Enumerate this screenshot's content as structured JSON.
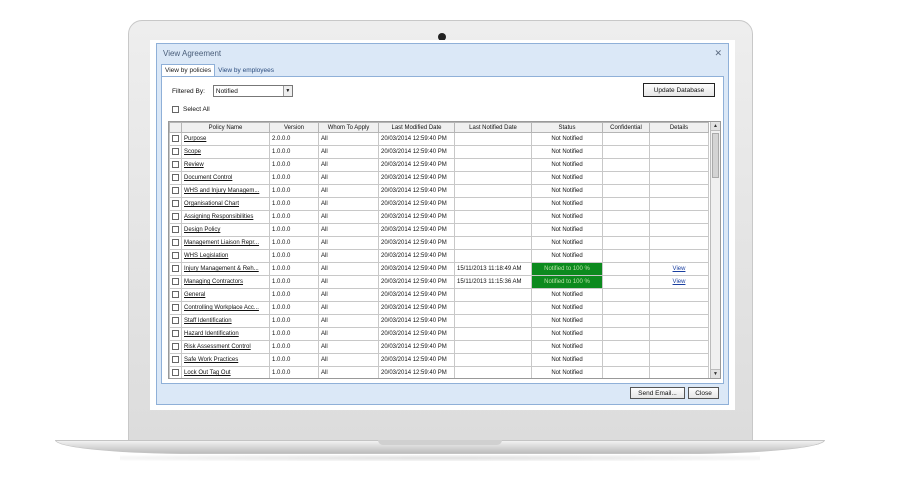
{
  "window": {
    "title": "View Agreement",
    "close_icon": "close-icon"
  },
  "tabs": [
    {
      "label": "View by policies",
      "active": true
    },
    {
      "label": "View by employees",
      "active": false
    }
  ],
  "filter": {
    "label": "Filtered By:",
    "value": "Notified"
  },
  "update_button": "Update Database",
  "select_all": "Select All",
  "columns": [
    "",
    "Policy Name",
    "Version",
    "Whom To Apply",
    "Last Modified Date",
    "Last Notified Date",
    "Status",
    "Confidential",
    "Details"
  ],
  "rows": [
    {
      "name": "Purpose",
      "version": "2.0.0.0",
      "apply": "All",
      "modified": "20/03/2014 12:59:40 PM",
      "notified": "",
      "status": "Not Notified",
      "confidential": "",
      "details": ""
    },
    {
      "name": "Scope",
      "version": "1.0.0.0",
      "apply": "All",
      "modified": "20/03/2014 12:59:40 PM",
      "notified": "",
      "status": "Not Notified",
      "confidential": "",
      "details": ""
    },
    {
      "name": "Review",
      "version": "1.0.0.0",
      "apply": "All",
      "modified": "20/03/2014 12:59:40 PM",
      "notified": "",
      "status": "Not Notified",
      "confidential": "",
      "details": ""
    },
    {
      "name": "Document Control",
      "version": "1.0.0.0",
      "apply": "All",
      "modified": "20/03/2014 12:59:40 PM",
      "notified": "",
      "status": "Not Notified",
      "confidential": "",
      "details": ""
    },
    {
      "name": "WHS and Injury Managem...",
      "version": "1.0.0.0",
      "apply": "All",
      "modified": "20/03/2014 12:59:40 PM",
      "notified": "",
      "status": "Not Notified",
      "confidential": "",
      "details": ""
    },
    {
      "name": "Organisational Chart",
      "version": "1.0.0.0",
      "apply": "All",
      "modified": "20/03/2014 12:59:40 PM",
      "notified": "",
      "status": "Not Notified",
      "confidential": "",
      "details": ""
    },
    {
      "name": "Assigning Responsibilities",
      "version": "1.0.0.0",
      "apply": "All",
      "modified": "20/03/2014 12:59:40 PM",
      "notified": "",
      "status": "Not Notified",
      "confidential": "",
      "details": ""
    },
    {
      "name": "Design Policy",
      "version": "1.0.0.0",
      "apply": "All",
      "modified": "20/03/2014 12:59:40 PM",
      "notified": "",
      "status": "Not Notified",
      "confidential": "",
      "details": ""
    },
    {
      "name": "Management Liaison Repr...",
      "version": "1.0.0.0",
      "apply": "All",
      "modified": "20/03/2014 12:59:40 PM",
      "notified": "",
      "status": "Not Notified",
      "confidential": "",
      "details": ""
    },
    {
      "name": "WHS Legislation",
      "version": "1.0.0.0",
      "apply": "All",
      "modified": "20/03/2014 12:59:40 PM",
      "notified": "",
      "status": "Not Notified",
      "confidential": "",
      "details": ""
    },
    {
      "name": "Injury Management & Reh...",
      "version": "1.0.0.0",
      "apply": "All",
      "modified": "20/03/2014 12:59:40 PM",
      "notified": "15/11/2013 11:18:49 AM",
      "status": "Notified to 100 %",
      "confidential": "",
      "details": "View"
    },
    {
      "name": "Managing Contractors",
      "version": "1.0.0.0",
      "apply": "All",
      "modified": "20/03/2014 12:59:40 PM",
      "notified": "15/11/2013 11:15:36 AM",
      "status": "Notified to 100 %",
      "confidential": "",
      "details": "View"
    },
    {
      "name": "General",
      "version": "1.0.0.0",
      "apply": "All",
      "modified": "20/03/2014 12:59:40 PM",
      "notified": "",
      "status": "Not Notified",
      "confidential": "",
      "details": ""
    },
    {
      "name": "Controlling Workplace Acc...",
      "version": "1.0.0.0",
      "apply": "All",
      "modified": "20/03/2014 12:59:40 PM",
      "notified": "",
      "status": "Not Notified",
      "confidential": "",
      "details": ""
    },
    {
      "name": "Staff Identification",
      "version": "1.0.0.0",
      "apply": "All",
      "modified": "20/03/2014 12:59:40 PM",
      "notified": "",
      "status": "Not Notified",
      "confidential": "",
      "details": ""
    },
    {
      "name": "Hazard Identification",
      "version": "1.0.0.0",
      "apply": "All",
      "modified": "20/03/2014 12:59:40 PM",
      "notified": "",
      "status": "Not Notified",
      "confidential": "",
      "details": ""
    },
    {
      "name": "Risk Assessment Control",
      "version": "1.0.0.0",
      "apply": "All",
      "modified": "20/03/2014 12:59:40 PM",
      "notified": "",
      "status": "Not Notified",
      "confidential": "",
      "details": ""
    },
    {
      "name": "Safe Work Practices",
      "version": "1.0.0.0",
      "apply": "All",
      "modified": "20/03/2014 12:59:40 PM",
      "notified": "",
      "status": "Not Notified",
      "confidential": "",
      "details": ""
    },
    {
      "name": "Lock Out Tag Out",
      "version": "1.0.0.0",
      "apply": "All",
      "modified": "20/03/2014 12:59:40 PM",
      "notified": "",
      "status": "Not Notified",
      "confidential": "",
      "details": ""
    }
  ],
  "footer": {
    "send_email": "Send Email...",
    "close": "Close"
  },
  "colors": {
    "window_bg": "#dbe8f7",
    "notified_green": "#0c8a1e",
    "link_blue": "#1a3fa0"
  }
}
